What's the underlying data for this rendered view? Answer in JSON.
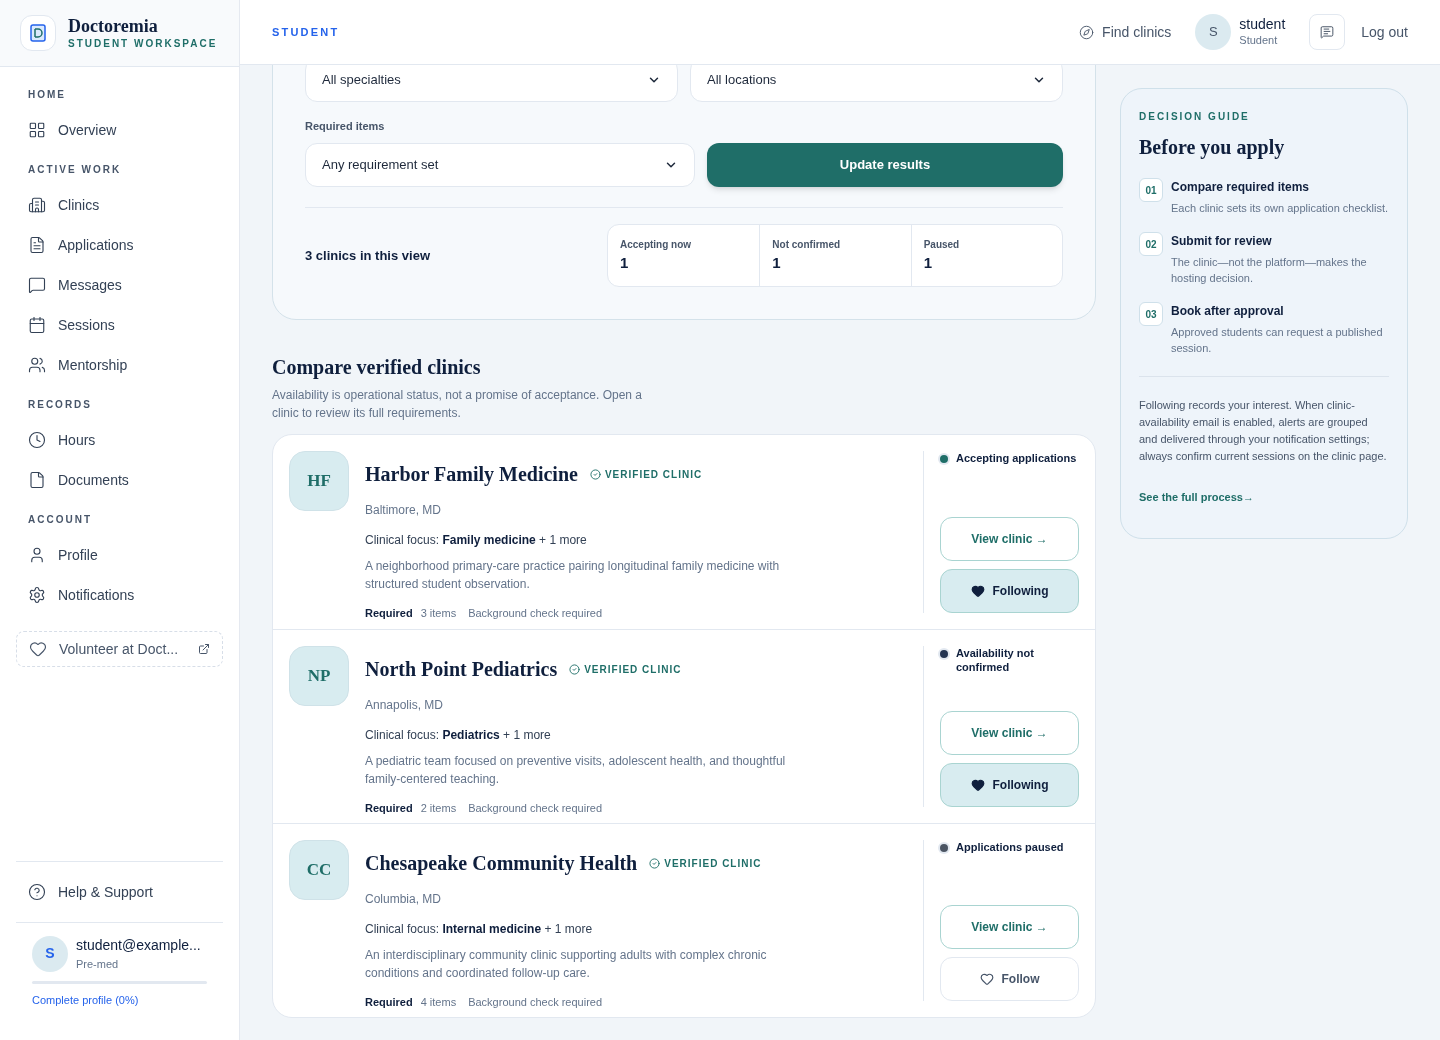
{
  "sidebar": {
    "brand": {
      "name": "Doctoremia",
      "subtitle": "STUDENT WORKSPACE"
    },
    "sections": [
      {
        "title": "HOME",
        "items": [
          {
            "label": "Overview",
            "selected": false
          }
        ]
      },
      {
        "title": "ACTIVE WORK",
        "items": [
          {
            "label": "Clinics",
            "selected": false
          },
          {
            "label": "Applications",
            "selected": false
          },
          {
            "label": "Messages",
            "selected": false
          },
          {
            "label": "Sessions",
            "selected": false
          },
          {
            "label": "Mentorship",
            "selected": false
          }
        ]
      },
      {
        "title": "RECORDS",
        "items": [
          {
            "label": "Hours",
            "selected": false
          },
          {
            "label": "Documents",
            "selected": false
          }
        ]
      },
      {
        "title": "ACCOUNT",
        "items": [
          {
            "label": "Profile",
            "selected": false
          },
          {
            "label": "Notifications",
            "selected": false
          }
        ]
      }
    ],
    "volunteer_link": "Volunteer at Doct...",
    "help": "Help & Support",
    "user": {
      "avatar": "S",
      "email": "student@example...",
      "role": "Pre-med",
      "level": 0,
      "profile_link": "Complete profile (0%)"
    }
  },
  "header": {
    "breadcrumb": "STUDENT",
    "find_clinics": "Find clinics",
    "avatar": "S",
    "name": "student",
    "role": "Student",
    "logout": "Log out"
  },
  "filters": {
    "fields": [
      {
        "value": "All specialties"
      },
      {
        "value": "All locations"
      }
    ],
    "required_label": "Required items",
    "required_value": "Any requirement set",
    "button": "Update results",
    "summary": "3 clinics in this view",
    "stats": [
      {
        "label": "Accepting now",
        "value": "1"
      },
      {
        "label": "Not confirmed",
        "value": "1"
      },
      {
        "label": "Paused",
        "value": "1"
      }
    ]
  },
  "compare": {
    "title": "Compare verified clinics",
    "description": "Availability is operational status, not a promise of acceptance. Open a clinic to review its full requirements.",
    "clinics": [
      {
        "initials": "HF",
        "name": "Harbor Family Medicine",
        "badge": "VERIFIED CLINIC",
        "location": "Baltimore, MD",
        "focus_label": "Clinical focus:",
        "focus": "Family medicine",
        "focus_more": "+ 1 more",
        "description": "A neighborhood primary-care practice pairing longitudinal family medicine with structured student observation.",
        "required_label": "Required",
        "required_count": "3 items",
        "check": "Background check required",
        "status": {
          "label": "Accepting applications",
          "color": "#1f6e68"
        },
        "view": "View clinic →",
        "follow": {
          "label": "Following",
          "following": true
        }
      },
      {
        "initials": "NP",
        "name": "North Point Pediatrics",
        "badge": "VERIFIED CLINIC",
        "location": "Annapolis, MD",
        "focus_label": "Clinical focus:",
        "focus": "Pediatrics",
        "focus_more": "+ 1 more",
        "description": "A pediatric team focused on preventive visits, adolescent health, and thoughtful family-centered teaching.",
        "required_label": "Required",
        "required_count": "2 items",
        "check": "Background check required",
        "status": {
          "label": "Availability not confirmed",
          "color": "#243552"
        },
        "view": "View clinic →",
        "follow": {
          "label": "Following",
          "following": true
        }
      },
      {
        "initials": "CC",
        "name": "Chesapeake Community Health",
        "badge": "VERIFIED CLINIC",
        "location": "Columbia, MD",
        "focus_label": "Clinical focus:",
        "focus": "Internal medicine",
        "focus_more": "+ 1 more",
        "description": "An interdisciplinary community clinic supporting adults with complex chronic conditions and coordinated follow-up care.",
        "required_label": "Required",
        "required_count": "4 items",
        "check": "Background check required",
        "status": {
          "label": "Applications paused",
          "color": "#4b5563"
        },
        "view": "View clinic →",
        "follow": {
          "label": "Follow",
          "following": false
        }
      }
    ]
  },
  "guide": {
    "eyebrow": "DECISION GUIDE",
    "title": "Before you apply",
    "steps": [
      {
        "number": "01",
        "title": "Compare required items",
        "text": "Each clinic sets its own application checklist."
      },
      {
        "number": "02",
        "title": "Submit for review",
        "text": "The clinic—not the platform—makes the hosting decision."
      },
      {
        "number": "03",
        "title": "Book after approval",
        "text": "Approved students can request a published session."
      }
    ],
    "note": "Following records your interest. When clinic-availability email is enabled, alerts are grouped and delivered through your notification settings; always confirm current sessions on the clinic page.",
    "link": "See the full process→"
  }
}
